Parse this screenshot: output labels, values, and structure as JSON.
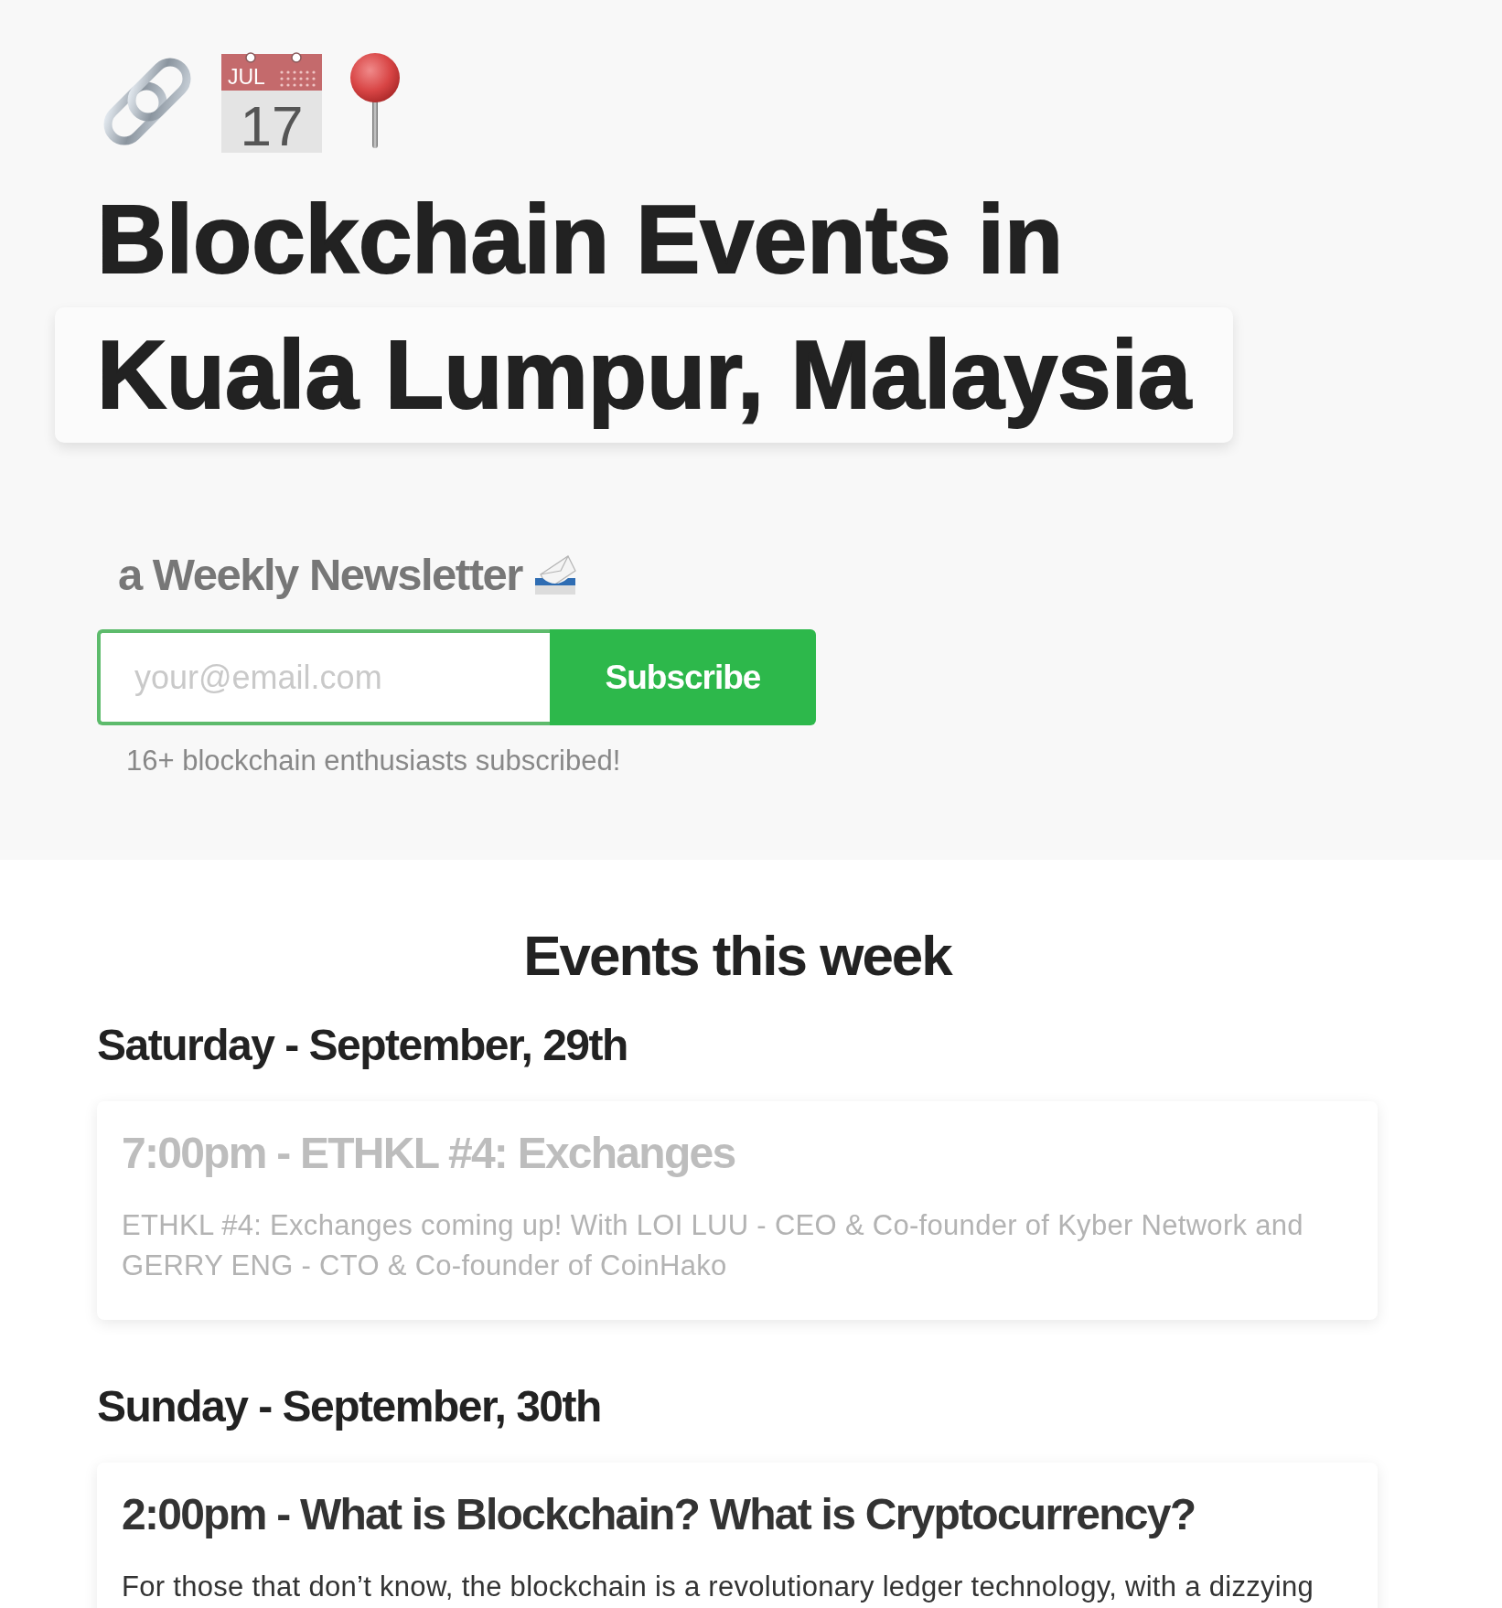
{
  "header": {
    "calendar_icon": {
      "month": "JUL",
      "day": "17"
    },
    "title_lines": [
      {
        "text": "Blockchain Events in",
        "highlighted": false
      },
      {
        "text": "Kuala Lumpur, Malaysia",
        "highlighted": true
      }
    ]
  },
  "newsletter": {
    "heading": "a Weekly Newsletter",
    "email": {
      "placeholder": "your@email.com"
    },
    "button": "Subscribe",
    "subscriber_note": "16+ blockchain enthusiasts subscribed!"
  },
  "events_section": {
    "title": "Events this week",
    "days": [
      {
        "heading": "Saturday - September, 29th",
        "events": [
          {
            "title": "7:00pm - ETHKL #4: Exchanges",
            "description": "ETHKL #4: Exchanges coming up! With LOI LUU - CEO & Co-founder of Kyber Network and GERRY ENG - CTO & Co-founder of CoinHako",
            "past": true
          }
        ]
      },
      {
        "heading": "Sunday - September, 30th",
        "events": [
          {
            "title": "2:00pm - What is Blockchain? What is Cryptocurrency?",
            "description": "For those that don’t know, the blockchain is a revolutionary ledger technology, with a dizzying",
            "past": false
          }
        ]
      }
    ]
  }
}
